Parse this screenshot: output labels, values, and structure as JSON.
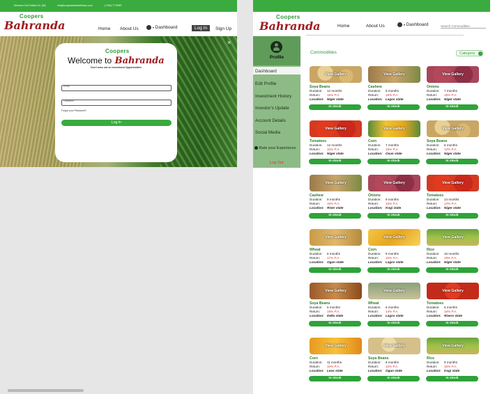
{
  "left": {
    "topbar": {
      "company": "Siemens Coil Fzdiles Co. [W]",
      "email": "info@coopersbombinfobaro.com",
      "phone": "(+234) 7770987"
    },
    "logo": {
      "small": "Coopers",
      "main": "Bahranda"
    },
    "nav": {
      "home": "Home",
      "about": "About Us",
      "dashboard": "Dashboard",
      "login": "Log In",
      "signup": "Sign Up"
    },
    "modal": {
      "close": "×",
      "logo_small": "Coopers",
      "welcome": "Welcome to",
      "brand": "Bahranda",
      "tagline": "Don't miss out on Investment Opportunities",
      "email_label": "Email",
      "password_label": "Password",
      "forgot": "Forgot your Password?",
      "login_button": "Log In"
    }
  },
  "right": {
    "logo": {
      "small": "Coopers",
      "main": "Bahranda"
    },
    "nav": {
      "home": "Home",
      "about": "About Us",
      "dashboard": "Dashboard"
    },
    "search": {
      "placeholder": "Search Commodities"
    },
    "sidebar": {
      "profile": "Profile",
      "items": [
        "Dashboard",
        "Edit Profile",
        "Investment History",
        "Investor's Update",
        "Account Details",
        "Social Media"
      ],
      "rate": "Rate your Experience",
      "logout": "Log Out"
    },
    "section_title": "Commodities",
    "category_label": "Category",
    "labels": {
      "duration": "Duration:",
      "return": "Return:",
      "location": "Location:",
      "gallery": "View Gallery",
      "stock": "In stock"
    },
    "cards": [
      {
        "name": "Soya Beans",
        "duration": "12 months",
        "ret": "15% P.A.",
        "location": "Niger state",
        "img": "soya"
      },
      {
        "name": "Cashew",
        "duration": "6 months",
        "ret": "18% P.A.",
        "location": "Lagos state",
        "img": "cashew"
      },
      {
        "name": "Onions",
        "duration": "7 months",
        "ret": "19% P.A.",
        "location": "Niger state",
        "img": "onion"
      },
      {
        "name": "Tomatoes",
        "duration": "12 months",
        "ret": "15% P.A.",
        "location": "Niger state",
        "img": "tomato"
      },
      {
        "name": "Corn",
        "duration": "7 months",
        "ret": "18% P.A.",
        "location": "Osun state",
        "img": "corn"
      },
      {
        "name": "Soya Beans",
        "duration": "6 months",
        "ret": "12% P.A.",
        "location": "Niger state",
        "img": "soya"
      },
      {
        "name": "Cashew",
        "duration": "9 months",
        "ret": "15% P.A.",
        "location": "River state",
        "img": "cashew"
      },
      {
        "name": "Onions",
        "duration": "9 months",
        "ret": "16% P.A.",
        "location": "Kogi state",
        "img": "onion"
      },
      {
        "name": "Tomatoes",
        "duration": "14 months",
        "ret": "12% P.A.",
        "location": "Niger state",
        "img": "tomato"
      },
      {
        "name": "Wheat",
        "duration": "8 months",
        "ret": "17% P.A.",
        "location": "Ogun state",
        "img": "wheat"
      },
      {
        "name": "Corn",
        "duration": "9 months",
        "ret": "10% P.A.",
        "location": "Lagos state",
        "img": "corn2"
      },
      {
        "name": "Rice",
        "duration": "16 months",
        "ret": "18% P.A.",
        "location": "Niger state",
        "img": "rice"
      },
      {
        "name": "Soya Beans",
        "duration": "5 months",
        "ret": "19% P.A.",
        "location": "Delta state",
        "img": "sticks"
      },
      {
        "name": "Wheat",
        "duration": "6 months",
        "ret": "14% P.A.",
        "location": "Lagos state",
        "img": "wheat2"
      },
      {
        "name": "Tomatoes",
        "duration": "6 months",
        "ret": "15% P.A.",
        "location": "Rivers state",
        "img": "tomato2"
      },
      {
        "name": "Corn",
        "duration": "11 months",
        "ret": "10% P.A.",
        "location": "Leos state",
        "img": "corn3"
      },
      {
        "name": "Soya Beans",
        "duration": "9 months",
        "ret": "12% P.A.",
        "location": "Ogun state",
        "img": "soya2"
      },
      {
        "name": "Rice",
        "duration": "9 months",
        "ret": "15% P.A.",
        "location": "Kogi state",
        "img": "rice"
      }
    ]
  },
  "colors": {
    "green": "#3aab3f",
    "brand": "#9e1b1e",
    "sidebar": "#8dbb85"
  },
  "icons": {
    "close": "close-icon",
    "user": "user-icon",
    "star": "star-icon",
    "category": "chevron-right-icon"
  }
}
